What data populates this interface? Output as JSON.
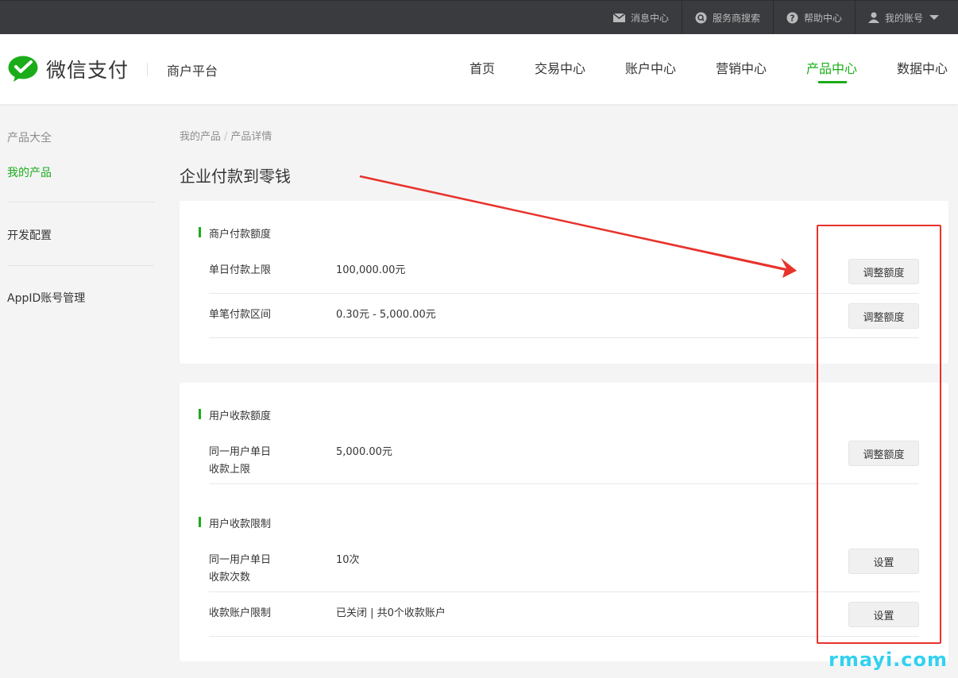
{
  "topbar": {
    "messages": "消息中心",
    "provider_search": "服务商搜索",
    "help": "帮助中心",
    "account": "我的账号"
  },
  "header": {
    "brand": "微信支付",
    "platform": "商户平台",
    "nav": [
      "首页",
      "交易中心",
      "账户中心",
      "营销中心",
      "产品中心",
      "数据中心"
    ],
    "active_nav": "产品中心"
  },
  "sidebar": {
    "items": [
      "产品大全",
      "我的产品",
      "开发配置",
      "AppID账号管理"
    ]
  },
  "breadcrumb": [
    "我的产品",
    "产品详情"
  ],
  "page_title": "企业付款到零钱",
  "card1": {
    "section_title": "商户付款额度",
    "rows": [
      {
        "label": "单日付款上限",
        "value": "100,000.00元",
        "button": "调整额度"
      },
      {
        "label": "单笔付款区间",
        "value": "0.30元 - 5,000.00元",
        "button": "调整额度"
      }
    ]
  },
  "card2": {
    "section1_title": "用户收款额度",
    "section1_rows": [
      {
        "label_line1": "同一用户单日",
        "label_line2": "收款上限",
        "value": "5,000.00元",
        "button": "调整额度"
      }
    ],
    "section2_title": "用户收款限制",
    "section2_rows": [
      {
        "label_line1": "同一用户单日",
        "label_line2": "收款次数",
        "value": "10次",
        "button": "设置"
      },
      {
        "label": "收款账户限制",
        "value": "已关闭 | 共0个收款账户",
        "button": "设置"
      }
    ]
  },
  "watermark": "rmayi.com",
  "colors": {
    "brand_green": "#1aad19",
    "annotation_red": "#e8322c",
    "watermark_blue": "#33d1f0",
    "topbar_bg": "#3a3b3e"
  }
}
